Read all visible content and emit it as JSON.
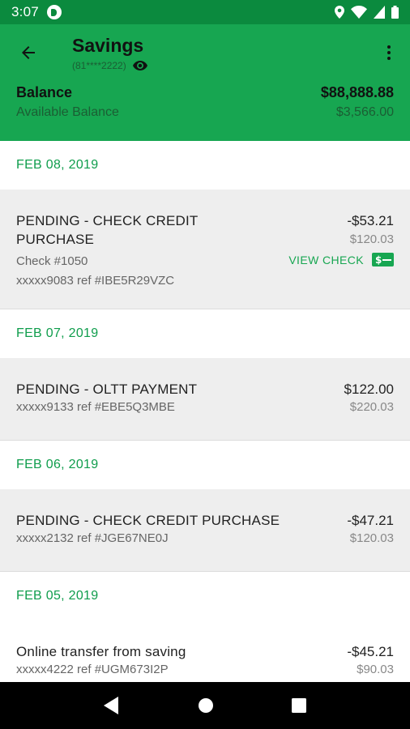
{
  "status_bar": {
    "time": "3:07"
  },
  "header": {
    "title": "Savings",
    "account_number": "(81****2222)",
    "balance_label": "Balance",
    "balance_value": "$88,888.88",
    "available_label": "Available Balance",
    "available_value": "$3,566.00"
  },
  "groups": [
    {
      "date": "FEB 08, 2019",
      "transactions": [
        {
          "title": "PENDING - CHECK CREDIT PURCHASE",
          "amount": "-$53.21",
          "running_balance": "$120.03",
          "check_number": "Check #1050",
          "ref": "xxxxx9083 ref #IBE5R29VZC",
          "view_check_label": "VIEW CHECK"
        }
      ]
    },
    {
      "date": "FEB 07, 2019",
      "transactions": [
        {
          "title": "PENDING - OLTT PAYMENT",
          "amount": "$122.00",
          "running_balance": "$220.03",
          "ref": "xxxxx9133 ref #EBE5Q3MBE"
        }
      ]
    },
    {
      "date": "FEB 06, 2019",
      "transactions": [
        {
          "title": "PENDING - CHECK CREDIT PURCHASE",
          "amount": "-$47.21",
          "running_balance": "$120.03",
          "ref": "xxxxx2132 ref #JGE67NE0J"
        }
      ]
    },
    {
      "date": "FEB 05, 2019",
      "transactions": [
        {
          "title": "Online transfer from saving",
          "amount": "-$45.21",
          "running_balance": "$90.03",
          "ref": "xxxxx4222 ref #UGM673I2P"
        }
      ]
    }
  ],
  "colors": {
    "status_bar": "#0b8a3e",
    "app_bar": "#17a651",
    "accent": "#0f9d4c",
    "row_bg": "#eeeeee"
  },
  "icons": {
    "back": "arrow-left-icon",
    "visibility": "eye-icon",
    "menu": "more-vert-icon",
    "check": "check-money-icon"
  }
}
